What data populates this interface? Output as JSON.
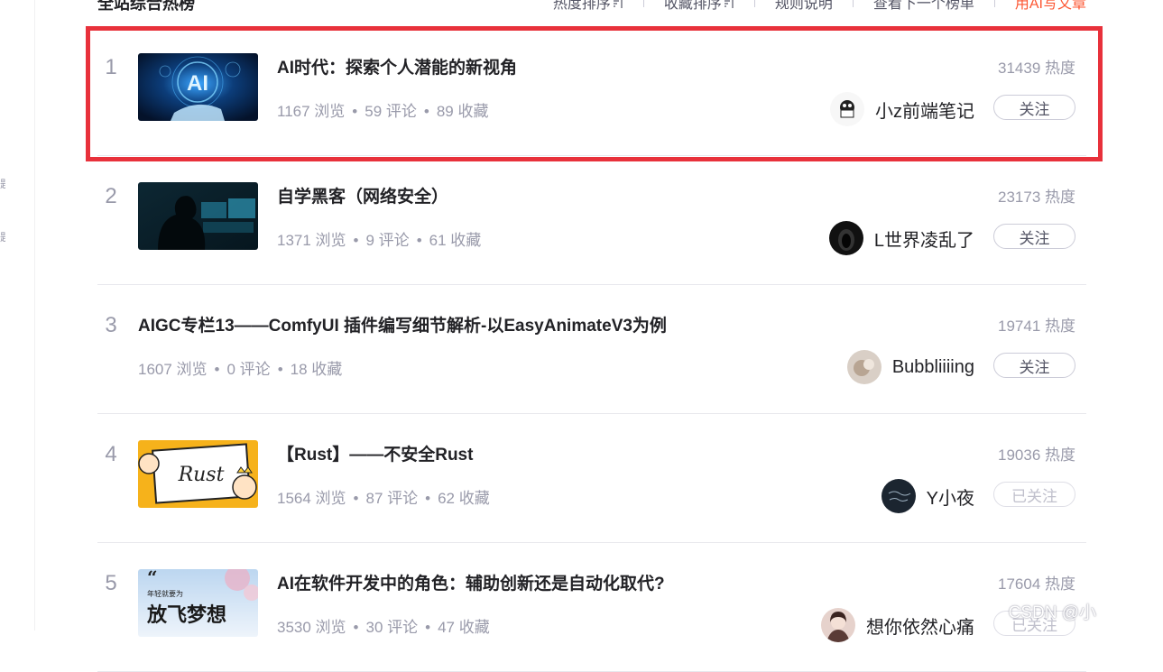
{
  "header": {
    "title": "全站综合热榜",
    "links": [
      {
        "label": "热度排序",
        "has_sort_icon": true
      },
      {
        "label": "收藏排序",
        "has_sort_icon": true
      },
      {
        "label": "规则说明"
      },
      {
        "label": "查看下一个榜单"
      },
      {
        "label": "用AI写文章",
        "accent": "#fc5531"
      }
    ]
  },
  "rail": {
    "marks": [
      "题",
      "题"
    ]
  },
  "items": [
    {
      "rank": "1",
      "title": "AI时代：探索个人潜能的新视角",
      "views": "1167 浏览",
      "comments": "59 评论",
      "favorites": "89 收藏",
      "heat": "31439 热度",
      "author": "小z前端笔记",
      "follow": "关注",
      "followed": false,
      "thumb_icon": "ai-hand-thumbnail",
      "thumb_text": "AI"
    },
    {
      "rank": "2",
      "title": "自学黑客（网络安全）",
      "views": "1371 浏览",
      "comments": "9 评论",
      "favorites": "61 收藏",
      "heat": "23173 热度",
      "author": "L世界凌乱了",
      "follow": "关注",
      "followed": false,
      "thumb_icon": "hacker-thumbnail"
    },
    {
      "rank": "3",
      "title": "AIGC专栏13——ComfyUI 插件编写细节解析-以EasyAnimateV3为例",
      "views": "1607 浏览",
      "comments": "0 评论",
      "favorites": "18 收藏",
      "heat": "19741 热度",
      "author": "Bubbliiiing",
      "follow": "关注",
      "followed": false
    },
    {
      "rank": "4",
      "title": "【Rust】——不安全Rust",
      "views": "1564 浏览",
      "comments": "87 评论",
      "favorites": "62 收藏",
      "heat": "19036 热度",
      "author": "Y小夜",
      "follow": "已关注",
      "followed": true,
      "thumb_icon": "rust-cartoon-thumbnail",
      "thumb_text": "Rust"
    },
    {
      "rank": "5",
      "title": "AI在软件开发中的角色：辅助创新还是自动化取代?",
      "views": "3530 浏览",
      "comments": "30 评论",
      "favorites": "47 收藏",
      "heat": "17604 热度",
      "author": "想你依然心痛",
      "follow": "已关注",
      "followed": true,
      "thumb_icon": "dream-poster-thumbnail",
      "thumb_text_small": "年轻就要为",
      "thumb_text": "放飞梦想"
    }
  ],
  "watermark": "CSDN @小",
  "colors": {
    "accent": "#fc5531",
    "highlight": "#e8313b",
    "muted": "#999aaa"
  }
}
